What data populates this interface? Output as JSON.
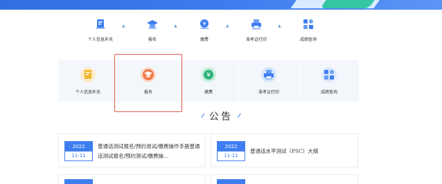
{
  "colors": {
    "primary": "#3f7ef0",
    "highlight_border": "#e25a4a",
    "card_bg": "#f3f7fc"
  },
  "steps": [
    {
      "label": "个人信息补充",
      "icon": "id-card-icon"
    },
    {
      "label": "报名",
      "icon": "graduation-cap-icon"
    },
    {
      "label": "缴费",
      "icon": "payment-icon"
    },
    {
      "label": "准考证打印",
      "icon": "printer-icon"
    },
    {
      "label": "成绩查询",
      "icon": "grid-icon"
    }
  ],
  "cards": [
    {
      "label": "个人信息补充",
      "icon": "id-card-icon",
      "selected": false
    },
    {
      "label": "报名",
      "icon": "graduation-cap-icon",
      "selected": true
    },
    {
      "label": "缴费",
      "icon": "payment-icon",
      "selected": false
    },
    {
      "label": "准考证打印",
      "icon": "printer-icon",
      "selected": false
    },
    {
      "label": "成绩查询",
      "icon": "grid-icon",
      "selected": false
    }
  ],
  "notice": {
    "title": "公告"
  },
  "news": [
    {
      "year": "2022",
      "date": "11-11",
      "title": "普通话测试报名/预约测试/缴费操作手册普通话测试报名/预约测试/缴费操…"
    },
    {
      "year": "2022",
      "date": "11-11",
      "title": "普通话水平测试（PSC）大纲"
    }
  ]
}
